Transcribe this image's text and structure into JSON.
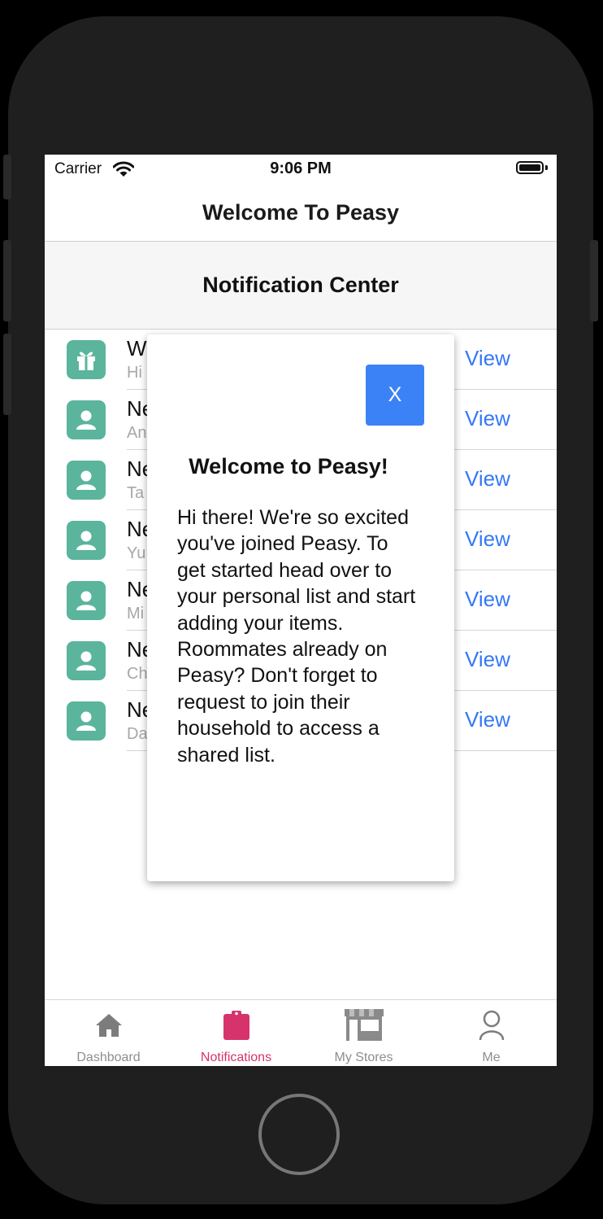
{
  "status_bar": {
    "carrier": "Carrier",
    "time": "9:06 PM"
  },
  "nav": {
    "title": "Welcome To Peasy"
  },
  "section": {
    "title": "Notification Center"
  },
  "notifications": [
    {
      "title": "W",
      "subtitle": "Hi",
      "icon": "gift-icon",
      "action": "View"
    },
    {
      "title": "Ne",
      "subtitle": "An",
      "icon": "person-icon",
      "action": "View"
    },
    {
      "title": "Ne",
      "subtitle": "Ta",
      "icon": "person-icon",
      "action": "View"
    },
    {
      "title": "Ne",
      "subtitle": "Yu",
      "icon": "person-icon",
      "action": "View"
    },
    {
      "title": "Ne",
      "subtitle": "Mi",
      "icon": "person-icon",
      "action": "View"
    },
    {
      "title": "Ne",
      "subtitle": "Ch",
      "icon": "person-icon",
      "action": "View"
    },
    {
      "title": "Ne",
      "subtitle": "Da",
      "icon": "person-icon",
      "action": "View"
    }
  ],
  "modal": {
    "close_label": "X",
    "title": "Welcome to Peasy!",
    "body": "Hi there! We're so excited you've joined Peasy. To get started head over to your personal list and start adding your items. Roommates already on Peasy? Don't forget to request to join their household to access a shared list."
  },
  "tabs": [
    {
      "label": "Dashboard",
      "icon": "home-icon",
      "active": false
    },
    {
      "label": "Notifications",
      "icon": "clipboard-icon",
      "active": true
    },
    {
      "label": "My Stores",
      "icon": "store-icon",
      "active": false
    },
    {
      "label": "Me",
      "icon": "user-icon",
      "active": false
    }
  ],
  "colors": {
    "accent": "#3478f6",
    "icon_tile": "#5bb49c",
    "active_tab": "#d6336c",
    "close_button": "#3b82f6"
  }
}
